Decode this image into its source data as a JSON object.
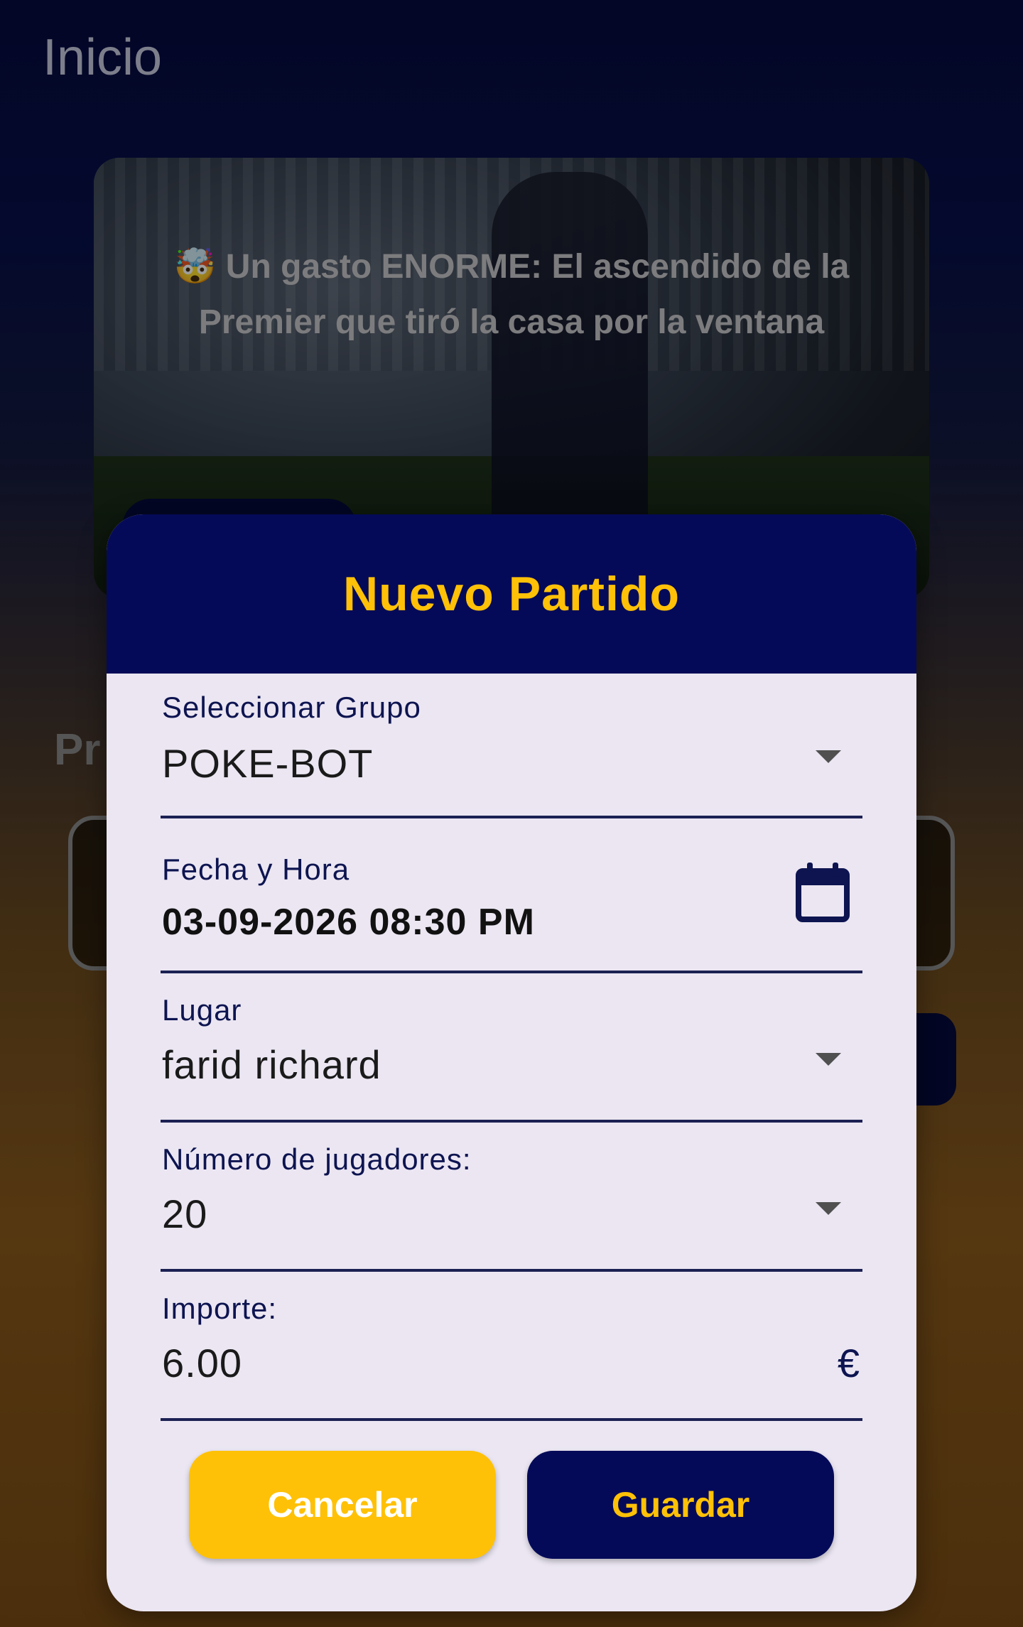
{
  "background": {
    "page_title": "Inicio",
    "news": {
      "headline": "🤯 Un gasto ENORME: El ascendido de la Premier que tiró la casa por la ventana"
    },
    "section_peek": "Pr"
  },
  "dialog": {
    "title": "Nuevo Partido",
    "fields": {
      "group": {
        "label": "Seleccionar Grupo",
        "value": "POKE-BOT",
        "icon": "chevron-down-icon"
      },
      "datetime": {
        "label": "Fecha y Hora",
        "value": "03-09-2026 08:30 PM",
        "icon": "calendar-icon"
      },
      "place": {
        "label": "Lugar",
        "value": "farid richard",
        "icon": "chevron-down-icon"
      },
      "players": {
        "label": "Número de jugadores:",
        "value": "20",
        "icon": "chevron-down-icon"
      },
      "amount": {
        "label": "Importe:",
        "value": "6.00",
        "suffix": "€"
      }
    },
    "actions": {
      "cancel_label": "Cancelar",
      "save_label": "Guardar"
    }
  },
  "colors": {
    "primary": "#050a58",
    "accent": "#ffc107",
    "dialog_bg": "#ebe6f2"
  }
}
